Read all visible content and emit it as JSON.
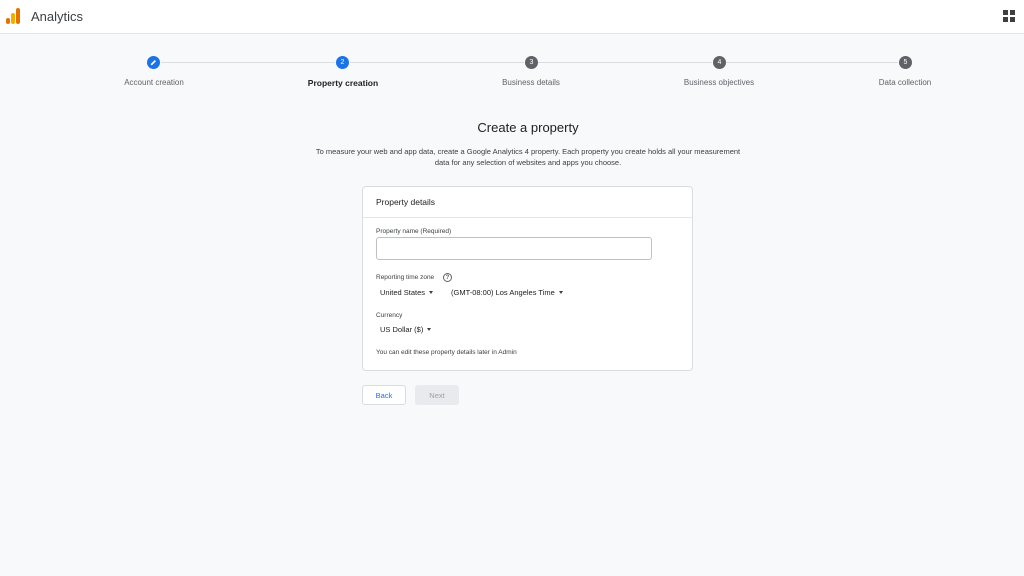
{
  "header": {
    "app_title": "Analytics",
    "logo_colors": [
      "#e37400",
      "#f9ab00",
      "#e37400"
    ]
  },
  "steps": [
    {
      "label": "Account creation",
      "marker": "",
      "state": "done",
      "icon": "pencil-icon"
    },
    {
      "label": "Property creation",
      "marker": "2",
      "state": "active"
    },
    {
      "label": "Business details",
      "marker": "3",
      "state": "pending"
    },
    {
      "label": "Business objectives",
      "marker": "4",
      "state": "pending"
    },
    {
      "label": "Data collection",
      "marker": "5",
      "state": "pending"
    }
  ],
  "colors": {
    "accent": "#1a73e8",
    "pending_step": "#5f6368"
  },
  "main": {
    "title": "Create a property",
    "description": "To measure your web and app data, create a Google Analytics 4 property. Each property you create holds all your measurement data for any selection of websites and apps you choose."
  },
  "card": {
    "title": "Property details",
    "property_name_label": "Property name (Required)",
    "property_name_value": "",
    "timezone_label": "Reporting time zone",
    "country_value": "United States",
    "timezone_value": "(GMT-08:00) Los Angeles Time",
    "currency_label": "Currency",
    "currency_value": "US Dollar ($)",
    "note": "You can edit these property details later in Admin",
    "help_icon": "help-circle-icon"
  },
  "actions": {
    "back_label": "Back",
    "next_label": "Next"
  }
}
